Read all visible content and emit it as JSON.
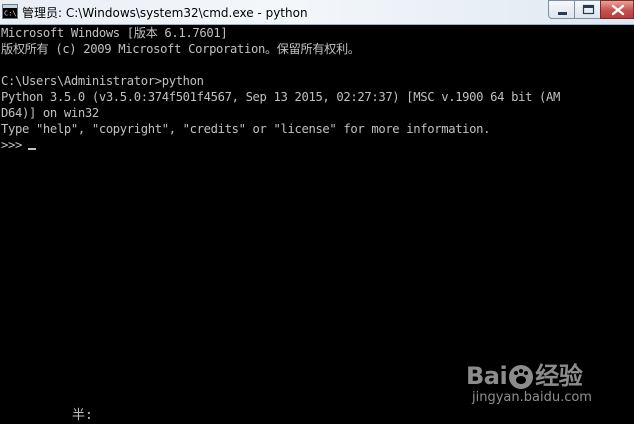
{
  "window": {
    "title": "管理员: C:\\Windows\\system32\\cmd.exe - python",
    "icon": "cmd-icon",
    "controls": {
      "minimize_icon": "minimize-icon",
      "maximize_icon": "maximize-icon",
      "close_icon": "close-icon"
    }
  },
  "console": {
    "lines": [
      "Microsoft Windows [版本 6.1.7601]",
      "版权所有 (c) 2009 Microsoft Corporation。保留所有权利。",
      "",
      "C:\\Users\\Administrator>python",
      "Python 3.5.0 (v3.5.0:374f501f4567, Sep 13 2015, 02:27:37) [MSC v.1900 64 bit (AM",
      "D64)] on win32",
      "Type \"help\", \"copyright\", \"credits\" or \"license\" for more information."
    ],
    "prompt": ">>>",
    "ime_status": "半:"
  },
  "watermark": {
    "logo_text_left": "Bai",
    "logo_text_right": "经验",
    "url": "jingyan.baidu.com"
  },
  "colors": {
    "console_background": "#000000",
    "console_text": "#c0c0c0",
    "titlebar": "#e9eef5",
    "close_button": "#c75050"
  }
}
